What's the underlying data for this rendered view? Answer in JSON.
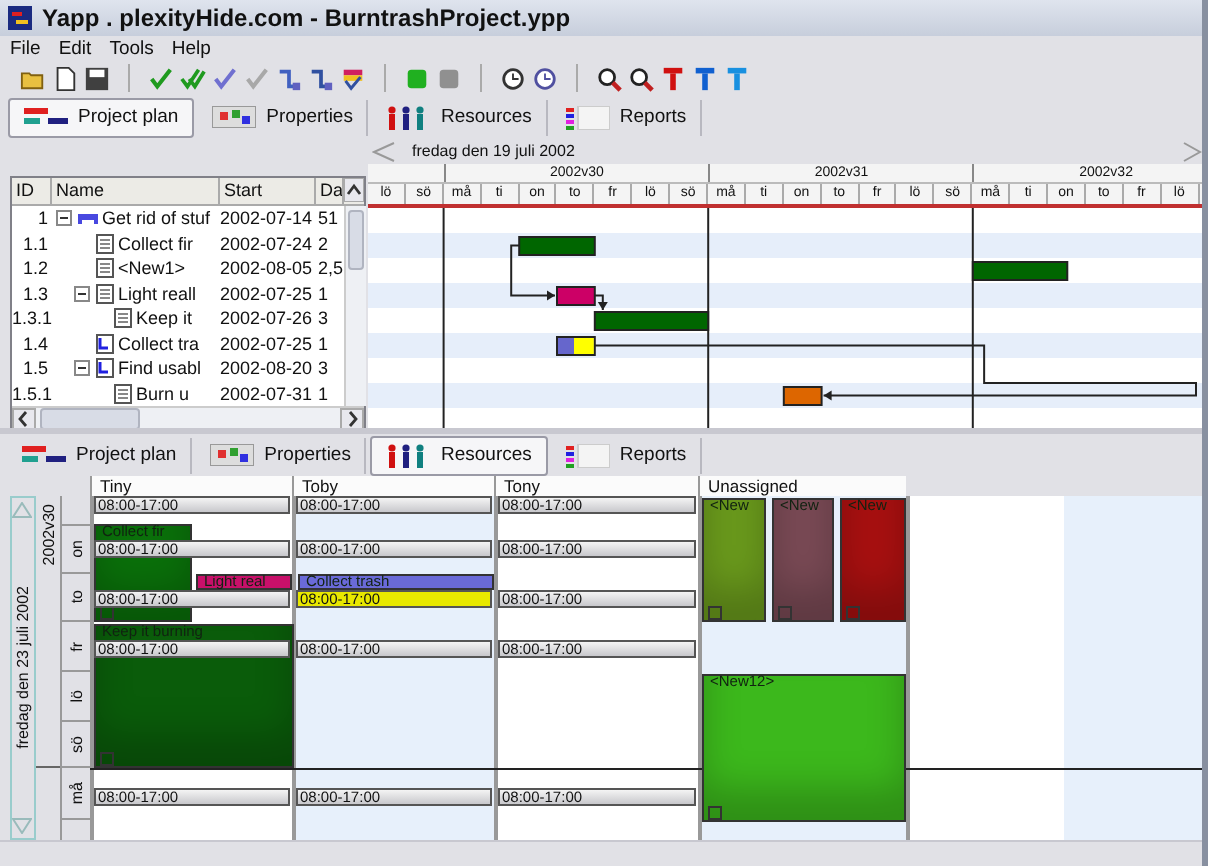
{
  "window": {
    "title": "Yapp . plexityHide.com - BurntrashProject.ypp"
  },
  "menu": [
    "File",
    "Edit",
    "Tools",
    "Help"
  ],
  "top_tabs": [
    {
      "label": "Project plan",
      "kind": "plan",
      "selected": true
    },
    {
      "label": "Properties",
      "kind": "properties",
      "selected": false
    },
    {
      "label": "Resources",
      "kind": "resources",
      "selected": false
    },
    {
      "label": "Reports",
      "kind": "reports",
      "selected": false
    }
  ],
  "project_plan": {
    "date_label": "fredag den 19 juli 2002",
    "columns": [
      "ID",
      "Name",
      "Start",
      "Da"
    ],
    "weeks": [
      "2002v30",
      "2002v31",
      "2002v32"
    ],
    "days": [
      "lö",
      "sö",
      "må",
      "ti",
      "on",
      "to",
      "fr",
      "lö",
      "sö",
      "må",
      "ti",
      "on",
      "to",
      "fr",
      "lö",
      "sö",
      "må",
      "ti",
      "on",
      "to",
      "fr",
      "lö"
    ],
    "tasks": [
      {
        "id": "1",
        "name": "Get rid of stuf",
        "start": "2002-07-14",
        "duration": "51",
        "kind": "summary",
        "expanded": true,
        "children": [
          {
            "id": "1.1",
            "name": "Collect fir",
            "start": "2002-07-24",
            "duration": "2",
            "kind": "task",
            "color": "#006600"
          },
          {
            "id": "1.2",
            "name": "<New1>",
            "start": "2002-08-05",
            "duration": "2,5",
            "kind": "task",
            "color": "#006600"
          },
          {
            "id": "1.3",
            "name": "Light reall",
            "start": "2002-07-25",
            "duration": "1",
            "kind": "task",
            "color": "#cc0066",
            "expanded": true,
            "children": [
              {
                "id": "1.3.1",
                "name": "Keep it",
                "start": "2002-07-26",
                "duration": "3",
                "kind": "task",
                "color": "#006600"
              }
            ]
          },
          {
            "id": "1.4",
            "name": "Collect tra",
            "start": "2002-07-25",
            "duration": "1",
            "kind": "linked",
            "color": "#6666cc",
            "progress": {
              "color": "#ffff00"
            }
          },
          {
            "id": "1.5",
            "name": "Find usabl",
            "start": "2002-08-20",
            "duration": "3",
            "kind": "linked",
            "expanded": true,
            "children": [
              {
                "id": "1.5.1",
                "name": "Burn u",
                "start": "2002-07-31",
                "duration": "1",
                "kind": "task",
                "color": "#dd6600"
              }
            ]
          }
        ]
      }
    ]
  },
  "bottom_tabs": [
    {
      "label": "Project plan",
      "kind": "plan",
      "selected": false
    },
    {
      "label": "Properties",
      "kind": "properties",
      "selected": false
    },
    {
      "label": "Resources",
      "kind": "resources",
      "selected": true
    },
    {
      "label": "Reports",
      "kind": "reports",
      "selected": false
    }
  ],
  "resource_view": {
    "date_label": "fredag den 23 juli 2002",
    "week_label": "2002v30",
    "days": [
      "on",
      "to",
      "fr",
      "lö",
      "sö",
      "må"
    ],
    "resources": [
      {
        "name": "Tiny",
        "shifts": [
          {
            "time": "08:00-17:00"
          },
          {
            "time": "08:00-17:00"
          },
          {
            "time": "08:00-17:00"
          },
          {
            "time": "08:00-17:00"
          },
          {
            "time": "08:00-17:00"
          }
        ],
        "tasks": [
          {
            "name": "Collect fir",
            "color": "#0a700a"
          },
          {
            "name": "Light real",
            "color": "#c8106a"
          },
          {
            "name": "Keep it burning",
            "color": "#0a5c0a"
          }
        ]
      },
      {
        "name": "Toby",
        "shifts": [
          {
            "time": "08:00-17:00"
          },
          {
            "time": "08:00-17:00"
          },
          {
            "time": "08:00-17:00",
            "color": "#e8e800"
          },
          {
            "time": "08:00-17:00"
          },
          {
            "time": "08:00-17:00"
          }
        ],
        "tasks": [
          {
            "name": "Collect trash",
            "color": "#6a6ad8"
          }
        ]
      },
      {
        "name": "Tony",
        "shifts": [
          {
            "time": "08:00-17:00"
          },
          {
            "time": "08:00-17:00"
          },
          {
            "time": "08:00-17:00"
          },
          {
            "time": "08:00-17:00"
          },
          {
            "time": "08:00-17:00"
          }
        ]
      },
      {
        "name": "Unassigned",
        "tasks": [
          {
            "name": "<New",
            "color": "#6a9a1c"
          },
          {
            "name": "<New",
            "color": "#7a4a55"
          },
          {
            "name": "<New",
            "color": "#a81010"
          },
          {
            "name": "<New12>",
            "color": "#3cb81c"
          }
        ]
      }
    ]
  }
}
